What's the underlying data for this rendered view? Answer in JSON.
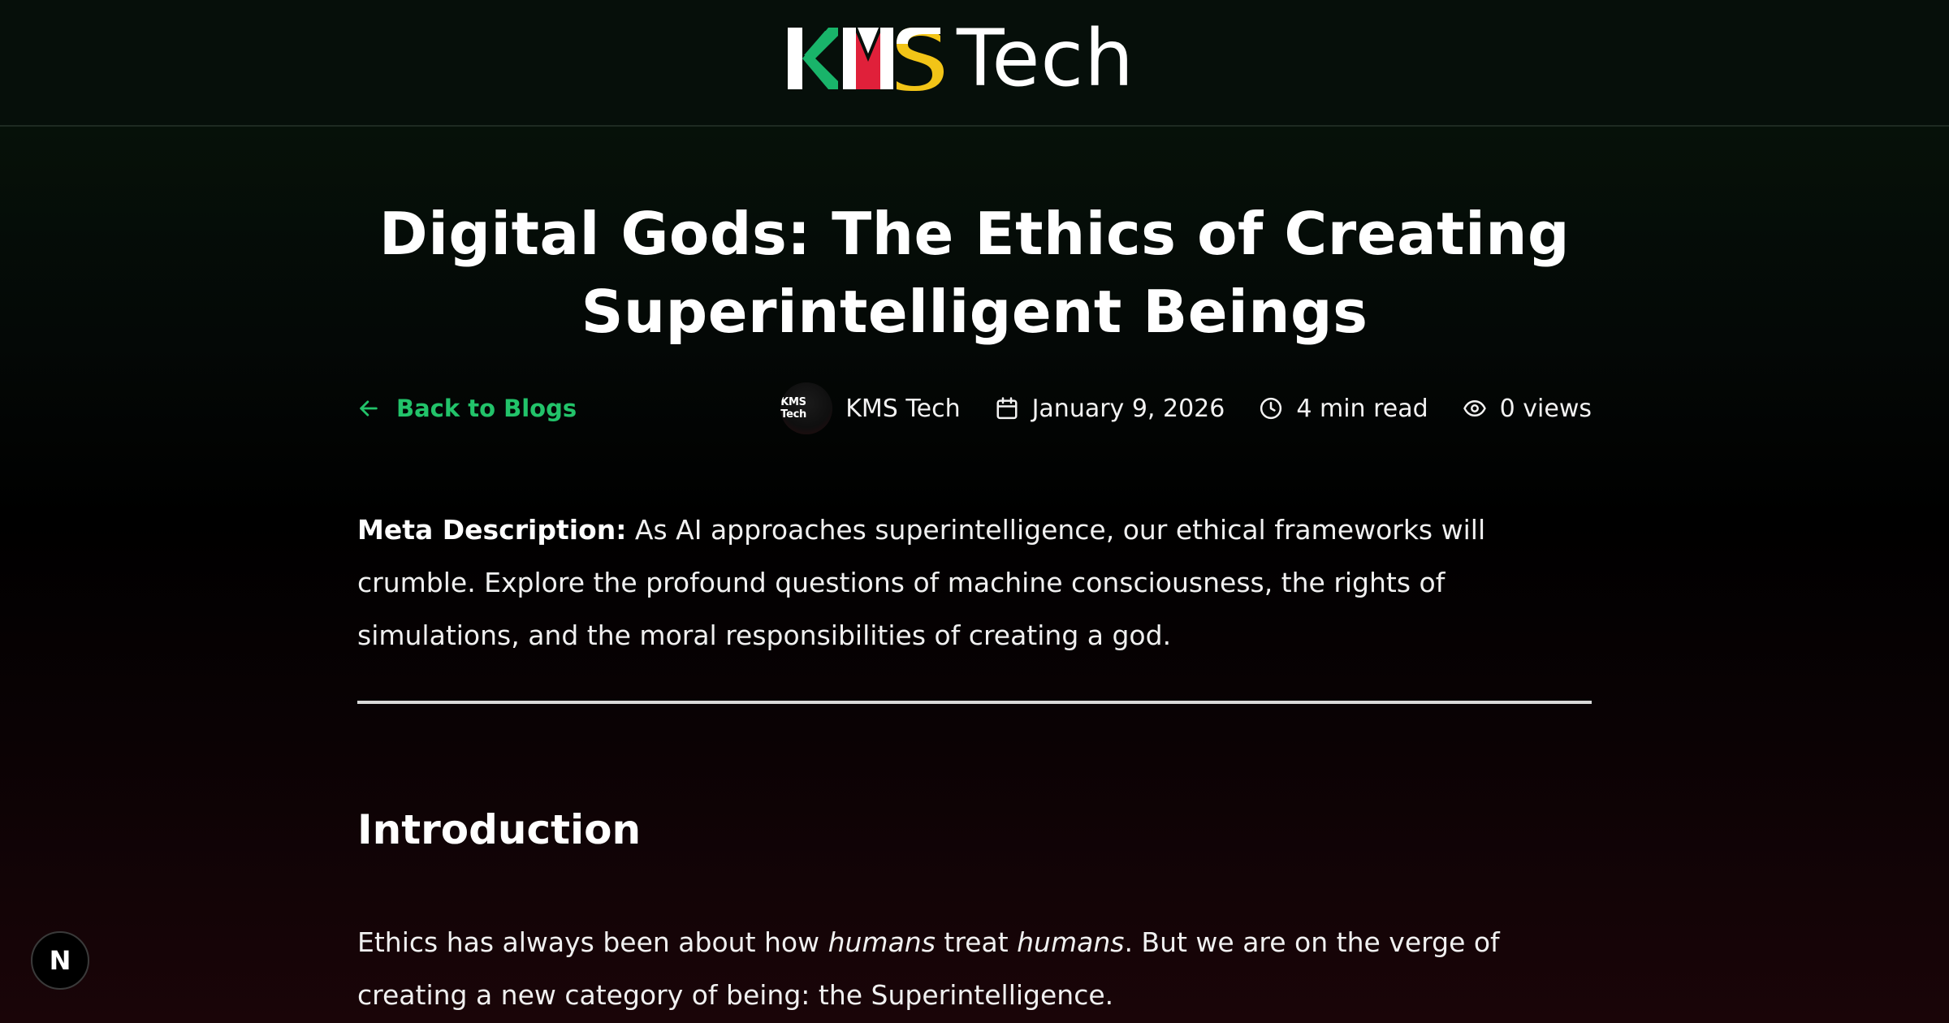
{
  "header": {
    "logo": {
      "mark_text": "KMS",
      "word": "Tech",
      "colors": {
        "k": "#19b46a",
        "m": "#e0203a",
        "s": "#f2c417"
      }
    }
  },
  "article": {
    "title": "Digital Gods: The Ethics of Creating Superintelligent Beings",
    "back_link": "Back to Blogs",
    "author": {
      "name": "KMS Tech",
      "avatar_text": "KMS Tech"
    },
    "date": "January 9, 2026",
    "read_time": "4 min read",
    "views": "0 views",
    "meta_description": {
      "label": "Meta Description:",
      "text": "As AI approaches superintelligence, our ethical frameworks will crumble. Explore the profound questions of machine consciousness, the rights of simulations, and the moral responsibilities of creating a god."
    },
    "sections": [
      {
        "heading": "Introduction",
        "paragraph": {
          "part1": "Ethics has always been about how ",
          "em1": "humans",
          "part2": " treat ",
          "em2": "humans",
          "part3": ". But we are on the verge of creating a new category of being: the Superintelligence."
        }
      }
    ]
  },
  "dev_badge": {
    "label": "N"
  },
  "icons": {
    "back": "arrow-left-icon",
    "date": "calendar-icon",
    "read_time": "clock-icon",
    "views": "eye-icon"
  },
  "colors": {
    "accent": "#22c36a",
    "background_top": "#06100b",
    "background_bottom": "#1a0508",
    "divider": "#d9d9d9"
  }
}
